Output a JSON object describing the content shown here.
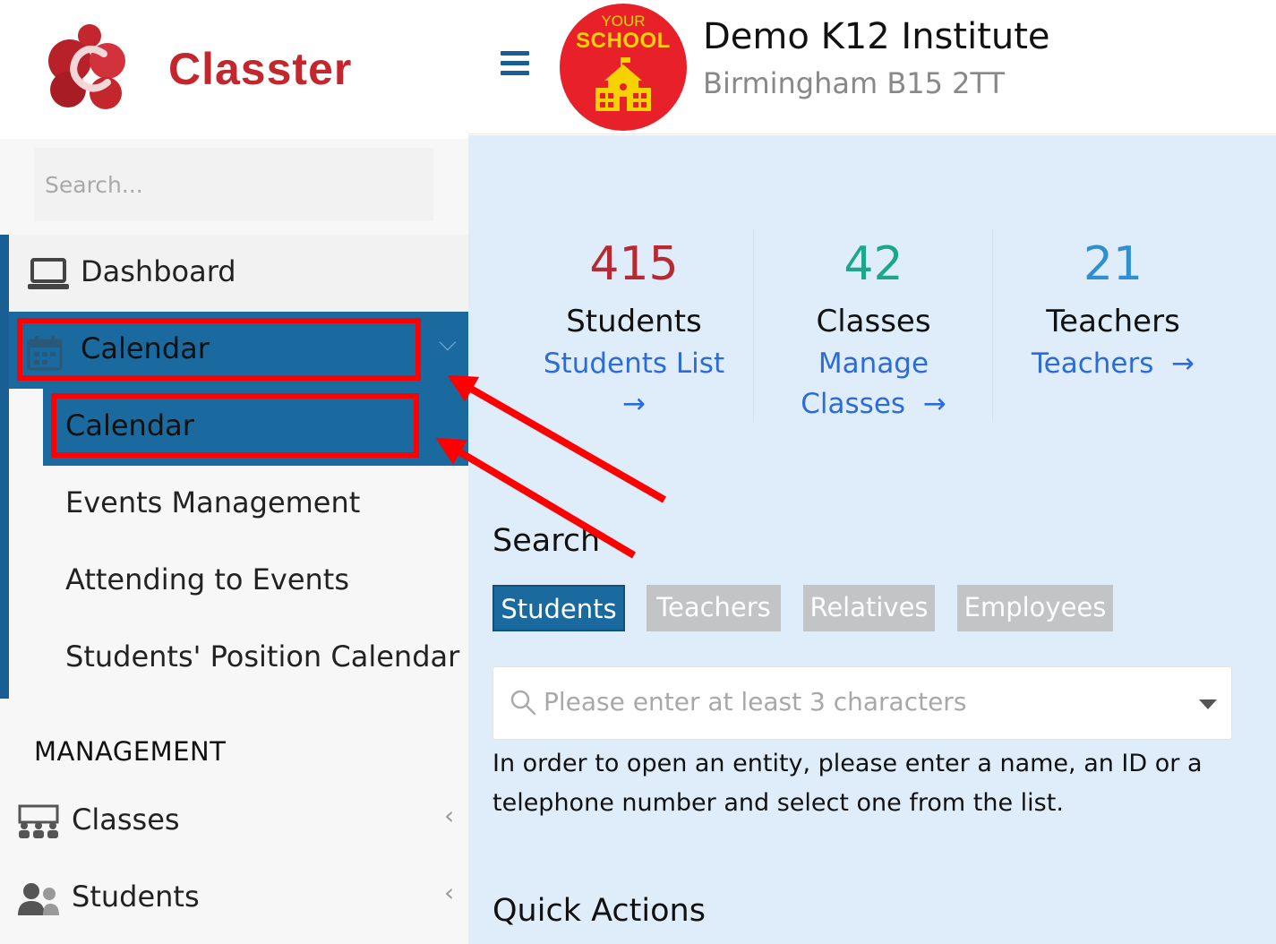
{
  "brand": {
    "name": "Classter",
    "accent": "#c4262e"
  },
  "sidebar": {
    "search_placeholder": "Search...",
    "dashboard_label": "Dashboard",
    "calendar_group_label": "Calendar",
    "calendar_items": [
      "Calendar",
      "Events Management",
      "Attending to Events",
      "Students' Position Calendar"
    ],
    "section_management": "MANAGEMENT",
    "management_items": [
      "Classes",
      "Students"
    ],
    "active_color": "#1a6aa0"
  },
  "header": {
    "school_logo_line1": "YOUR",
    "school_logo_line2": "SCHOOL",
    "institute_name": "Demo K12 Institute",
    "institute_address": "Birmingham B15 2TT"
  },
  "stats": [
    {
      "value": "415",
      "label": "Students",
      "link_line1": "Students List",
      "link_line2": "→",
      "color": "#b52a33"
    },
    {
      "value": "42",
      "label": "Classes",
      "link_line1": "Manage",
      "link_line2": "Classes  →",
      "color": "#1ea68c"
    },
    {
      "value": "21",
      "label": "Teachers",
      "link_line1": "Teachers  →",
      "link_line2": "",
      "color": "#2f8fd0"
    }
  ],
  "search": {
    "title": "Search",
    "tabs": [
      "Students",
      "Teachers",
      "Relatives",
      "Employees"
    ],
    "active_tab": "Students",
    "placeholder": "Please enter at least 3 characters",
    "help_text": "In order to open an entity, please enter a name, an ID or a telephone number and select one from the list."
  },
  "quick_actions_title": "Quick Actions",
  "annotation_color": "#ff0000"
}
